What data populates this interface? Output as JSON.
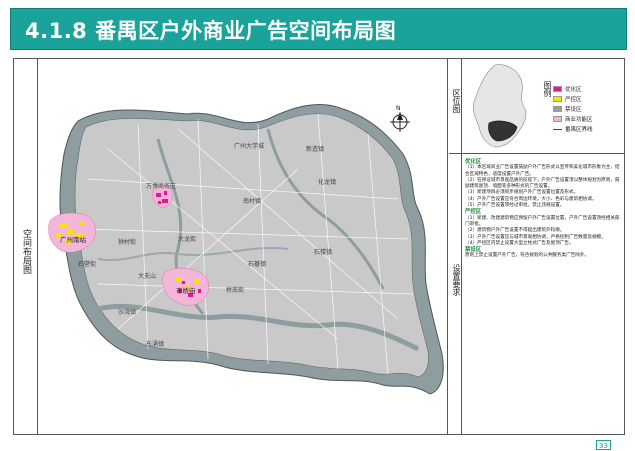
{
  "header": {
    "title": "4.1.8 番禺区户外商业广告空间布局图"
  },
  "left_panel": {
    "label": "空间布局图"
  },
  "map": {
    "north_label": "N",
    "places": {
      "dafu_shan": "大夫山",
      "shiqiao": "市桥街",
      "shilou": "石楼镇",
      "dalong": "大龙街",
      "shawan": "沙湾镇",
      "shibi": "石壁街",
      "nancun": "南村镇",
      "dongchong": "东涌镇",
      "hualong": "化龙镇",
      "zhongcun": "钟村街",
      "wanbo": "万博商务区",
      "guangzhounan": "广州南站",
      "qiaonan": "桥南街",
      "shiji": "石碁镇",
      "xinzao": "新造镇",
      "guangzhou_univ": "广州大学城"
    }
  },
  "sidebar": {
    "location_label": "区位图",
    "legend_label": "图例",
    "legend": [
      {
        "label": "优化区",
        "color": "#e8168c"
      },
      {
        "label": "严控区",
        "color": "#f5e600"
      },
      {
        "label": "禁设区",
        "color": "#9e9e9e"
      },
      {
        "label": "商业功能区",
        "color": "#f3b5d8"
      },
      {
        "label": "番禺区界线",
        "color": "#444444"
      }
    ],
    "notes_label": "设置要求",
    "notes": [
      {
        "type": "h",
        "text": "优化区"
      },
      {
        "type": "p",
        "text": "（1）本区域商业广告设置鼓励户外广告形式以宣传和美化城市形象为主，结合区域特色，适度设置户外广告。"
      },
      {
        "type": "p",
        "text": "（2）在保证城市景观品质的前提下，户外广告设置须以整体规划为原则，鼓励建筑屋顶、墙面等多种形式的广告设置。"
      },
      {
        "type": "p",
        "text": "（3）新建项目必须同步规划户外广告设置位置及形式。"
      },
      {
        "type": "p",
        "text": "（4）户外广告设置应符合周边环境，大小、色彩与建筑相协调。"
      },
      {
        "type": "p",
        "text": "（5）户外广告设置须经过审批，禁止违规设置。"
      },
      {
        "type": "h",
        "text": "严控区"
      },
      {
        "type": "p",
        "text": "（1）新建、改建建筑物应预留户外广告设置位置，户外广告设置须经相关部门审批。"
      },
      {
        "type": "p",
        "text": "（2）建筑物户外广告设置不得超出建筑外轮廓。"
      },
      {
        "type": "p",
        "text": "（3）户外广告设置应与城市景观相协调，严格控制广告数量及规模。"
      },
      {
        "type": "p",
        "text": "（4）严控区内禁止设置大型立柱式广告及屋顶广告。"
      },
      {
        "type": "h",
        "text": "禁设区"
      },
      {
        "type": "p",
        "text": "原则上禁止设置户外广告，符合规划的公共服务类广告除外。"
      }
    ]
  },
  "footer": {
    "page_number": "33"
  }
}
